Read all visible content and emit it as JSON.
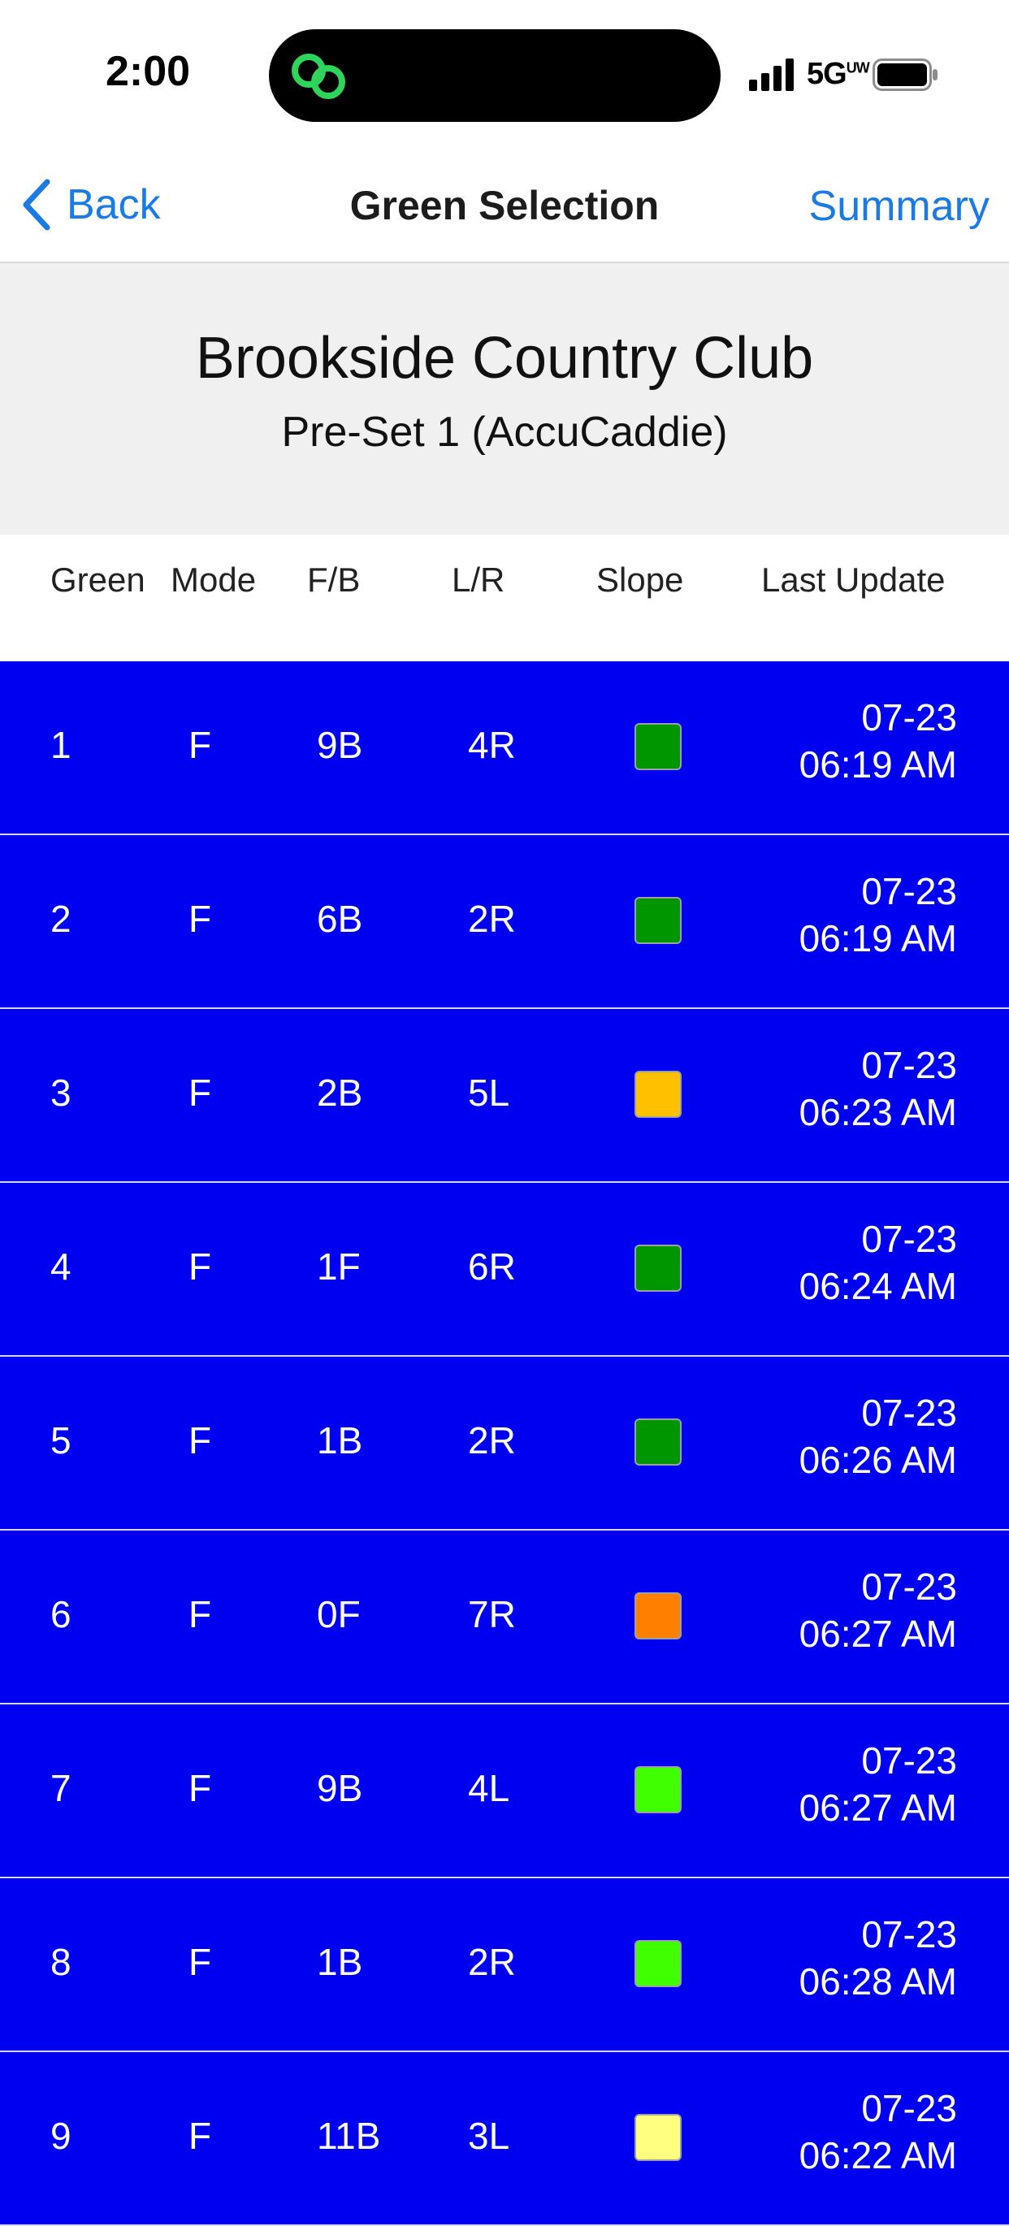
{
  "status_bar": {
    "time": "2:00",
    "network": "5G",
    "network_suffix": "UW",
    "icons": [
      "app-activity-icon",
      "signal-bars-icon",
      "battery-icon"
    ]
  },
  "nav": {
    "back_label": "Back",
    "title": "Green Selection",
    "summary_label": "Summary"
  },
  "header": {
    "course_name": "Brookside Country Club",
    "preset": "Pre-Set 1 (AccuCaddie)"
  },
  "columns": [
    "Green",
    "Mode",
    "F/B",
    "L/R",
    "Slope",
    "Last Update"
  ],
  "colors": {
    "row_background": "#0000f0",
    "accent_blue": "#1a7ae6"
  },
  "rows": [
    {
      "green": "1",
      "mode": "F",
      "fb": "9B",
      "lr": "4R",
      "slope_color": "#009600",
      "date": "07-23",
      "time": "06:19 AM"
    },
    {
      "green": "2",
      "mode": "F",
      "fb": "6B",
      "lr": "2R",
      "slope_color": "#009600",
      "date": "07-23",
      "time": "06:19 AM"
    },
    {
      "green": "3",
      "mode": "F",
      "fb": "2B",
      "lr": "5L",
      "slope_color": "#ffc000",
      "date": "07-23",
      "time": "06:23 AM"
    },
    {
      "green": "4",
      "mode": "F",
      "fb": "1F",
      "lr": "6R",
      "slope_color": "#009600",
      "date": "07-23",
      "time": "06:24 AM"
    },
    {
      "green": "5",
      "mode": "F",
      "fb": "1B",
      "lr": "2R",
      "slope_color": "#009600",
      "date": "07-23",
      "time": "06:26 AM"
    },
    {
      "green": "6",
      "mode": "F",
      "fb": "0F",
      "lr": "7R",
      "slope_color": "#ff8000",
      "date": "07-23",
      "time": "06:27 AM"
    },
    {
      "green": "7",
      "mode": "F",
      "fb": "9B",
      "lr": "4L",
      "slope_color": "#40ff00",
      "date": "07-23",
      "time": "06:27 AM"
    },
    {
      "green": "8",
      "mode": "F",
      "fb": "1B",
      "lr": "2R",
      "slope_color": "#40ff00",
      "date": "07-23",
      "time": "06:28 AM"
    },
    {
      "green": "9",
      "mode": "F",
      "fb": "11B",
      "lr": "3L",
      "slope_color": "#ffff80",
      "date": "07-23",
      "time": "06:22 AM"
    }
  ]
}
